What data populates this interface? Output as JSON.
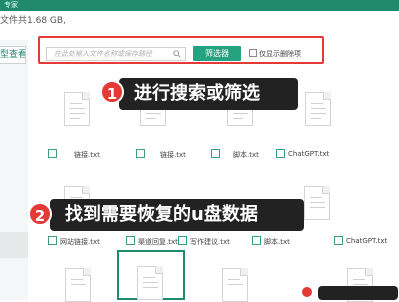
{
  "header": {
    "title": "专家"
  },
  "summary_text": "文件共1.68 GB,",
  "sidebar": {
    "tab_label": "型查看"
  },
  "filter": {
    "search_placeholder": "在此处输入文件名称或保存路径",
    "filter_button": "筛选器",
    "deleted_only_label": "仅显示删除项"
  },
  "files_row1": [
    "链接.txt",
    "链接.txt",
    "脚本.txt",
    "ChatGPT.txt"
  ],
  "files_row2": [
    "网站链接.txt",
    "渠道回复.txt",
    "写作建议.txt",
    "脚本.txt",
    "ChatGPT.txt"
  ],
  "callouts": [
    {
      "number": "1",
      "text": "进行搜索或筛选"
    },
    {
      "number": "2",
      "text": "找到需要恢复的u盘数据"
    }
  ],
  "colors": {
    "accent": "#25a27f",
    "highlight": "#e53935",
    "callout_bg": "#222222"
  }
}
